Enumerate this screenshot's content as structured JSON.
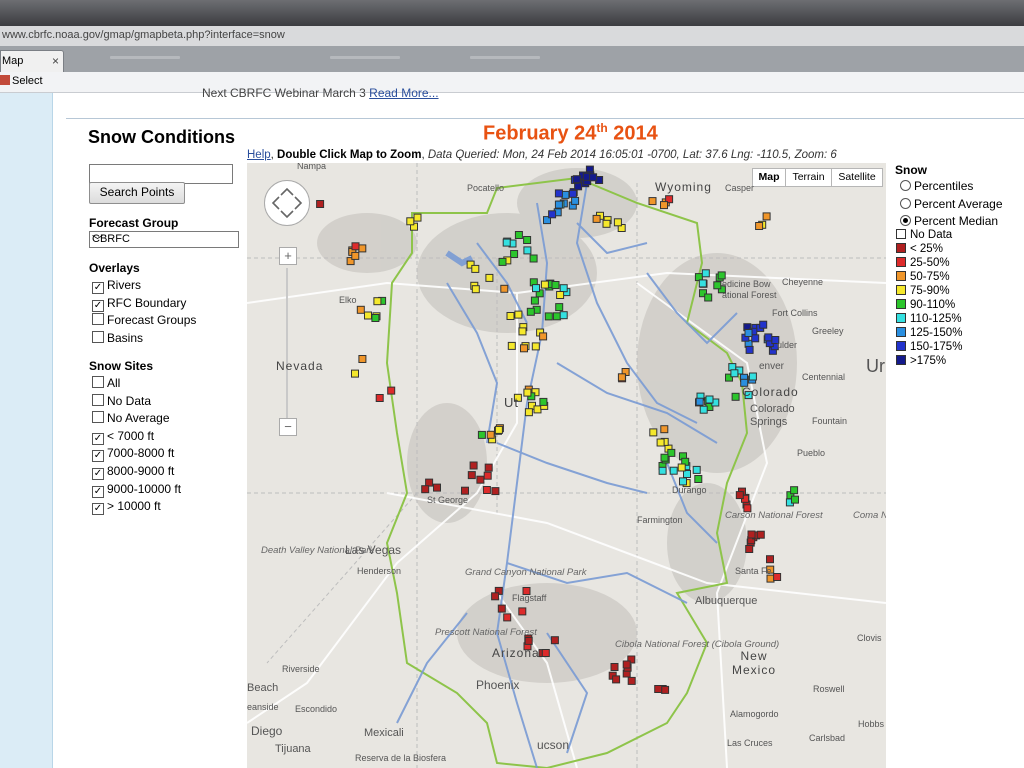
{
  "browser": {
    "url": "www.cbrfc.noaa.gov/gmap/gmapbeta.php?interface=snow",
    "tab_title": "Map",
    "tab_close": "×",
    "command_select": "Select"
  },
  "page": {
    "webinar_text": "Next CBRFC Webinar March 3",
    "webinar_link": "Read More...",
    "heading": "Snow Conditions",
    "date_title": "February 24",
    "date_suffix": "th",
    "date_year": " 2014",
    "info": {
      "help": "Help",
      "dblclick": "Double Click Map to Zoom",
      "queried": "Data Queried: Mon, 24 Feb 2014 16:05:01 -0700, Lat: 37.6 Lng: -110.5, Zoom: 6"
    }
  },
  "sidebar": {
    "search_placeholder": "",
    "search_button": "Search Points",
    "forecast_group_label": "Forecast Group",
    "forecast_group_value": "CBRFC",
    "overlays_label": "Overlays",
    "overlays": [
      {
        "label": "Rivers",
        "checked": true
      },
      {
        "label": "RFC Boundary",
        "checked": true
      },
      {
        "label": "Forecast Groups",
        "checked": false
      },
      {
        "label": "Basins",
        "checked": false
      }
    ],
    "snow_sites_label": "Snow Sites",
    "snow_sites": [
      {
        "label": "All",
        "checked": false
      },
      {
        "label": "No Data",
        "checked": false
      },
      {
        "label": "No Average",
        "checked": false
      },
      {
        "label": "< 7000 ft",
        "checked": true
      },
      {
        "label": "7000-8000 ft",
        "checked": true
      },
      {
        "label": "8000-9000 ft",
        "checked": true
      },
      {
        "label": "9000-10000 ft",
        "checked": true
      },
      {
        "label": "> 10000 ft",
        "checked": true
      }
    ]
  },
  "map": {
    "type_buttons": [
      "Map",
      "Terrain",
      "Satellite"
    ],
    "zoom_plus": "+",
    "zoom_minus": "−",
    "labels": {
      "wyoming": "Wyoming",
      "casper": "Casper",
      "pocatello": "Pocatello",
      "nampa": "Nampa",
      "elko": "Elko",
      "nevada": "Nevada",
      "utah": "Ut",
      "stgeorge": "St George",
      "lasvegas": "Las Vegas",
      "henderson": "Henderson",
      "deathvalley": "Death Valley National Park",
      "grandcanyon": "Grand Canyon National Park",
      "flagstaff": "Flagstaff",
      "prescott": "Prescott National Forest",
      "arizona": "Arizona",
      "phoenix": "Phoenix",
      "riverside": "Riverside",
      "beach": "Beach",
      "oceanside": "eanside",
      "escondido": "Escondido",
      "sandiego": "Diego",
      "tijuana": "Tijuana",
      "mexicali": "Mexicali",
      "reserva": "Reserva de la Biosfera",
      "tucson": "ucson",
      "cheyenne": "Cheyenne",
      "medbow": "edicine Bow",
      "natforest": "ational Forest",
      "ftcollins": "Fort Collins",
      "greeley": "Greeley",
      "boulder": "ulder",
      "denver": "enver",
      "centennial": "Centennial",
      "colorado": "Colorado",
      "cosprings": "Colorado Springs",
      "fountain": "Fountain",
      "pueblo": "Pueblo",
      "durango": "Durango",
      "farmington": "Farmington",
      "carson": "Carson National Forest",
      "santafe": "Santa Fe",
      "albuquerque": "Albuquerque",
      "cibola": "Cibola National Forest (Cibola Ground)",
      "newmexico": "New Mexico",
      "clovis": "Clovis",
      "roswell": "Roswell",
      "alamogordo": "Alamogordo",
      "lascruces": "Las Cruces",
      "carlsbad": "Carlsbad",
      "hobbs": "Hobbs",
      "coma": "Coma Natic Grass",
      "us": "Ur"
    }
  },
  "legend": {
    "title": "Snow",
    "modes": [
      {
        "label": "Percentiles",
        "selected": false
      },
      {
        "label": "Percent Average",
        "selected": false
      },
      {
        "label": "Percent Median",
        "selected": true
      }
    ],
    "classes": [
      {
        "label": "No Data",
        "color": "#ffffff"
      },
      {
        "label": "< 25%",
        "color": "#b02020"
      },
      {
        "label": "25-50%",
        "color": "#dd2b2b"
      },
      {
        "label": "50-75%",
        "color": "#f0962a"
      },
      {
        "label": "75-90%",
        "color": "#f5e82c"
      },
      {
        "label": "90-110%",
        "color": "#2cc52c"
      },
      {
        "label": "110-125%",
        "color": "#34e0e0"
      },
      {
        "label": "125-150%",
        "color": "#2a8fe0"
      },
      {
        "label": "150-175%",
        "color": "#2233cc"
      },
      {
        "label": ">175%",
        "color": "#141a8c"
      }
    ]
  },
  "colors": {
    "title_orange": "#e85212",
    "link_blue": "#2a4e9c",
    "river_blue": "#7a9bd4",
    "boundary_green": "#8ec44a"
  }
}
